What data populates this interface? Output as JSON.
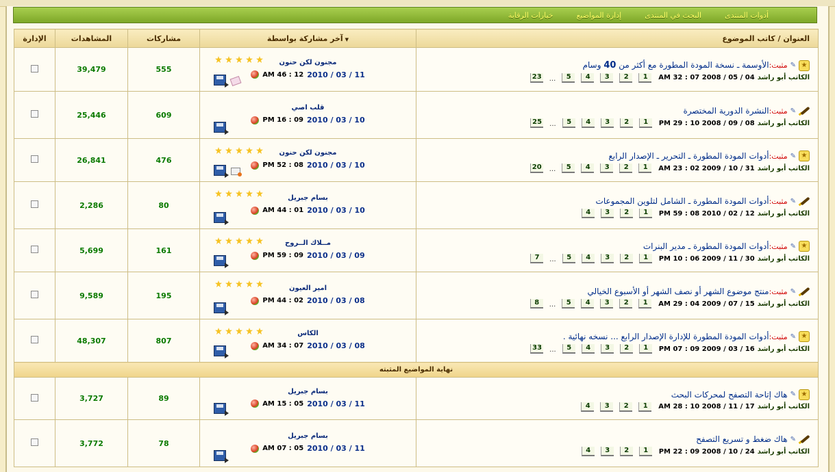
{
  "nav": {
    "items": [
      "أدوات المنتدى",
      "البحث في المنتدى",
      "إدارة المواضيع",
      "خيارات الرقابة"
    ]
  },
  "table": {
    "headers": {
      "title": "العنوان / كاتب الموضوع",
      "last_post": "آخر مشاركة بواسطة",
      "replies": "مشاركات",
      "views": "المشاهدات",
      "admin": "الإدارة"
    },
    "sticky_end_label": "نهاية المواضيع المثبته",
    "sticky_rows": [
      {
        "icon": "star",
        "prefix": "مثبت:",
        "title": "الأوسمة ـ نسخة المودة المطورة مع أكثر من ",
        "title_bold": "40",
        "title_tail": " وسام",
        "author": "الكاتب أبو راشد",
        "date": "04 / 05 / 2008 07 : 32 AM",
        "pages": [
          "1",
          "2",
          "3",
          "4",
          "5",
          "...",
          "23"
        ],
        "rating": 5,
        "extra_icon": "tag",
        "last_name": "مجنون لكن حنون",
        "last_date": "11 / 03 / 2010",
        "last_time": "12 : 46 AM",
        "replies": "555",
        "views": "39,479"
      },
      {
        "icon": "pen",
        "prefix": "مثبت:",
        "title": "النشرة الدورية المختصرة",
        "title_bold": "",
        "title_tail": "",
        "author": "الكاتب أبو راشد",
        "date": "08 / 09 / 2008 10 : 29 PM",
        "pages": [
          "1",
          "2",
          "3",
          "4",
          "5",
          "...",
          "25"
        ],
        "rating": 0,
        "extra_icon": "",
        "last_name": "قلب اصي",
        "last_date": "10 / 03 / 2010",
        "last_time": "09 : 16 PM",
        "replies": "609",
        "views": "25,446"
      },
      {
        "icon": "star",
        "prefix": "مثبت:",
        "title": "أدوات المودة المطورة ـ التحرير ـ الإصدار الرابع",
        "title_bold": "",
        "title_tail": "",
        "author": "الكاتب أبو راشد",
        "date": "31 / 10 / 2009 02 : 23 AM",
        "pages": [
          "1",
          "2",
          "3",
          "4",
          "5",
          "...",
          "20"
        ],
        "rating": 5,
        "extra_icon": "mail",
        "last_name": "مجنون لكن حنون",
        "last_date": "10 / 03 / 2010",
        "last_time": "08 : 52 PM",
        "replies": "476",
        "views": "26,841"
      },
      {
        "icon": "pen",
        "prefix": "مثبت:",
        "title": "أدوات المودة المطورة ـ الشامل لتلوين المجموعات",
        "title_bold": "",
        "title_tail": "",
        "author": "الكاتب أبو راشد",
        "date": "12 / 02 / 2010 08 : 59 PM",
        "pages": [
          "1",
          "2",
          "3",
          "4"
        ],
        "rating": 5,
        "extra_icon": "",
        "last_name": "بسام جبريل",
        "last_date": "10 / 03 / 2010",
        "last_time": "01 : 44 AM",
        "replies": "80",
        "views": "2,286"
      },
      {
        "icon": "star",
        "prefix": "مثبت:",
        "title": "أدوات المودة المطورة ـ مدير البنرات",
        "title_bold": "",
        "title_tail": "",
        "author": "الكاتب أبو راشد",
        "date": "30 / 11 / 2009 06 : 10 PM",
        "pages": [
          "1",
          "2",
          "3",
          "4",
          "5",
          "...",
          "7"
        ],
        "rating": 5,
        "extra_icon": "",
        "last_name": "مــلاك الــروح",
        "last_date": "09 / 03 / 2010",
        "last_time": "09 : 59 PM",
        "replies": "161",
        "views": "5,699"
      },
      {
        "icon": "pen",
        "prefix": "مثبت:",
        "title": "منتج موضوع الشهر أو نصف الشهر أو الأسبوع الخيالي",
        "title_bold": "",
        "title_tail": "",
        "author": "الكاتب أبو راشد",
        "date": "15 / 07 / 2009 04 : 29 AM",
        "pages": [
          "1",
          "2",
          "3",
          "4",
          "5",
          "...",
          "8"
        ],
        "rating": 5,
        "extra_icon": "",
        "last_name": "امير العيون",
        "last_date": "08 / 03 / 2010",
        "last_time": "02 : 44 PM",
        "replies": "195",
        "views": "9,589"
      },
      {
        "icon": "star",
        "prefix": "مثبت:",
        "title": "أدوات المودة المطورة للإدارة الإصدار الرابع ... نسخه نهائية .",
        "title_bold": "",
        "title_tail": "",
        "author": "الكاتب أبو راشد",
        "date": "16 / 03 / 2009 09 : 07 PM",
        "pages": [
          "1",
          "2",
          "3",
          "4",
          "5",
          "...",
          "33"
        ],
        "rating": 5,
        "extra_icon": "",
        "last_name": "الكاس",
        "last_date": "08 / 03 / 2010",
        "last_time": "07 : 34 AM",
        "replies": "807",
        "views": "48,307"
      }
    ],
    "normal_rows": [
      {
        "icon": "star",
        "prefix": "",
        "title": "هاك إتاحة التصفح لمحركات البحث",
        "title_bold": "",
        "title_tail": "",
        "author": "الكاتب أبو راشد",
        "date": "17 / 11 / 2008 10 : 28 AM",
        "pages": [
          "1",
          "2",
          "3",
          "4"
        ],
        "rating": 0,
        "extra_icon": "",
        "last_name": "بسام جبريل",
        "last_date": "11 / 03 / 2010",
        "last_time": "05 : 15 AM",
        "replies": "89",
        "views": "3,727"
      },
      {
        "icon": "pen",
        "prefix": "",
        "title": "هاك ضغط و تسريع التصفح",
        "title_bold": "",
        "title_tail": "",
        "author": "الكاتب أبو راشد",
        "date": "24 / 10 / 2008 09 : 22 PM",
        "pages": [
          "1",
          "2",
          "3",
          "4"
        ],
        "rating": 0,
        "extra_icon": "",
        "last_name": "بسام جبريل",
        "last_date": "11 / 03 / 2010",
        "last_time": "05 : 07 AM",
        "replies": "78",
        "views": "3,772"
      }
    ]
  }
}
